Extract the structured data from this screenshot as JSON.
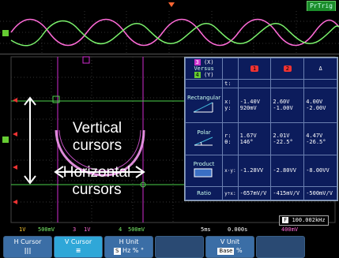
{
  "trigger_badge": "PrTrig",
  "annotations": {
    "vertical": "Vertical\ncursors",
    "horizontal": "Horizontal\ncursors"
  },
  "table": {
    "header": {
      "ch1": "3",
      "ch1_label": "(X)",
      "versus": "Versus",
      "ch2": "4",
      "ch2_label": "(Y)",
      "col1": "1",
      "col2": "2",
      "col3": "Δ"
    },
    "rows": [
      {
        "name": "Rectangular",
        "k1": "x:",
        "k2": "y:",
        "c1a": "-1.40V",
        "c1b": "920mV",
        "c2a": "2.60V",
        "c2b": "-1.00V",
        "c3a": "4.00V",
        "c3b": "-2.00V"
      },
      {
        "name": "Polar",
        "k1": "r:",
        "k2": "θ:",
        "c1a": "1.67V",
        "c1b": "146°",
        "c2a": "2.01V",
        "c2b": "-22.5°",
        "c3a": "4.47V",
        "c3b": "-26.5°"
      },
      {
        "name": "Product",
        "k1": "x·y:",
        "c1a": "-1.28VV",
        "c2a": "-2.80VV",
        "c3a": "-8.00VV"
      },
      {
        "name": "Ratio",
        "k1": "y÷x:",
        "c1a": "-657mV/V",
        "c2a": "-415mV/V",
        "c3a": "-500mV/V"
      }
    ]
  },
  "status": {
    "freq": "100.002kHz",
    "timebase": "5ms",
    "hpos": "0.000s",
    "ch1_scale": "1V",
    "ch1b_scale": "500mV",
    "left_text": "1 ═ 500mV",
    "ch3": "3",
    "ch4": "4",
    "ch3_scale": "1V",
    "ch4_scale": "500mV",
    "trig_level": "400mV"
  },
  "softkeys": [
    {
      "title": "H Cursor",
      "icon": "|||",
      "state": "norm"
    },
    {
      "title": "V Cursor",
      "icon": "≡",
      "state": "act"
    },
    {
      "title": "H Unit",
      "sub": "Hz % °",
      "box": "S",
      "state": "norm"
    },
    {
      "title": "",
      "state": "dim"
    },
    {
      "title": "V Unit",
      "sub": "%",
      "box": "Base",
      "state": "norm"
    },
    {
      "title": "",
      "state": "dim"
    }
  ]
}
